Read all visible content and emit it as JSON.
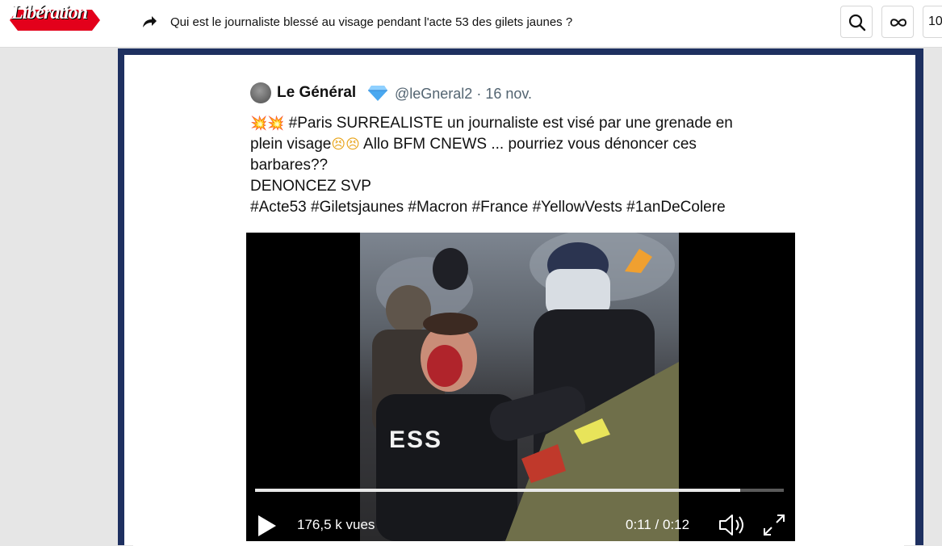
{
  "header": {
    "logo_text": "Libération",
    "headline": "Qui est le journaliste blessé au visage pendant l'acte 53 des gilets jaunes ?",
    "partial_button_text": "10",
    "brand_color": "#e3001b"
  },
  "tweet": {
    "author_name": "Le Général",
    "handle_date": "@leGneral2 · 16 nov.",
    "verified_badge": "💎",
    "lines": {
      "l1_emoji": "💥💥",
      "l1_text": " #Paris SURREALISTE un journaliste est visé par une grenade en",
      "l2_text_a": "plein visage",
      "l2_emoji": "😣😣",
      "l2_text_b": " Allo BFM CNEWS ... pourriez vous dénoncer ces",
      "l3_text": "barbares??",
      "l4_text": "DENONCEZ SVP",
      "l5_text": "#Acte53 #Giletsjaunes #Macron #France #YellowVests #1anDeColere"
    }
  },
  "video": {
    "still_label": "ESS",
    "views": "176,5 k vues",
    "time": "0:11 / 0:12",
    "progress": 0.917
  },
  "colors": {
    "frame": "#1e3060",
    "handle": "#536471"
  }
}
